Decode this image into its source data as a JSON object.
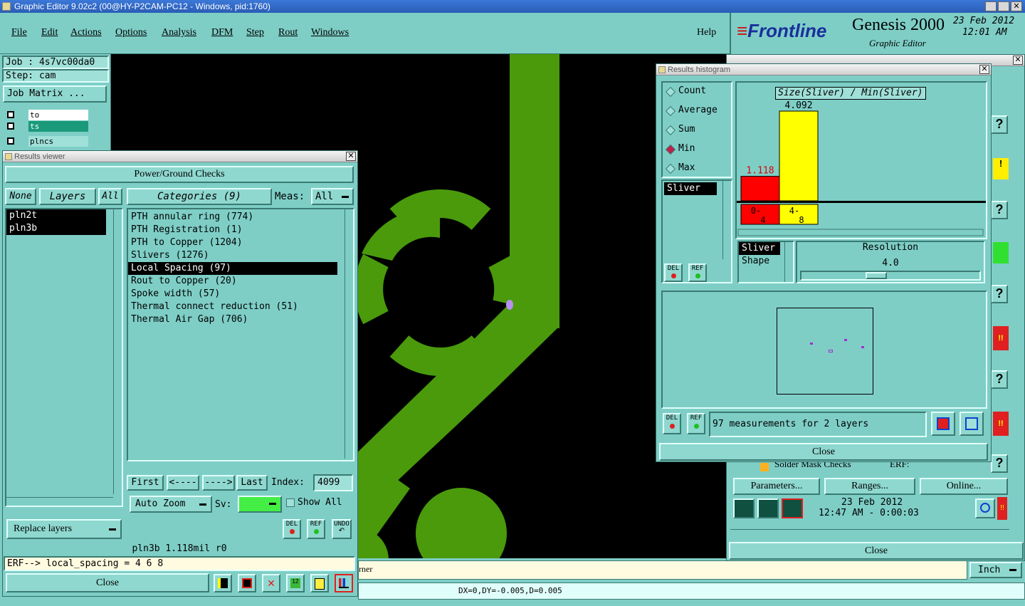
{
  "os_titlebar": {
    "title": "Graphic Editor 9.02c2 (00@HY-P2CAM-PC12 - Windows, pid:1760)"
  },
  "menu": {
    "items": [
      "File",
      "Edit",
      "Actions",
      "Options",
      "Analysis",
      "DFM",
      "Step",
      "Rout",
      "Windows"
    ],
    "help": "Help"
  },
  "brand": {
    "logo": "Frontline",
    "product": "Genesis 2000",
    "subtitle": "Graphic Editor",
    "date": "23 Feb 2012",
    "time": "12:01 AM"
  },
  "job_panel": {
    "job": "Job : 4s7vc00da0",
    "step": "Step: cam",
    "job_matrix": "Job Matrix ...",
    "layers": [
      {
        "name": "to"
      },
      {
        "name": "ts"
      },
      {
        "name": "plncs"
      }
    ]
  },
  "results_viewer": {
    "title": "Results viewer",
    "group": "Power/Ground Checks",
    "none_btn": "None",
    "layers_btn": "Layers",
    "all_btn": "All",
    "categories_btn": "Categories (9)",
    "meas_label": "Meas:",
    "meas_value": "All",
    "layer_list": [
      "pln2t",
      "pln3b"
    ],
    "categories": [
      "PTH annular ring (774)",
      "PTH Registration (1)",
      "PTH to Copper (1204)",
      "Slivers (1276)",
      "Local Spacing (97)",
      "Rout to Copper (20)",
      "Spoke width (57)",
      "Thermal connect reduction (51)",
      "Thermal Air Gap (706)"
    ],
    "selected_category": 4,
    "first": "First",
    "prev": "<----",
    "next": "---->",
    "last": "Last",
    "index_label": "Index:",
    "index_value": "4099",
    "auto_zoom": "Auto Zoom",
    "sv_label": "Sv:",
    "show_all": "Show All",
    "replace_layers": "Replace layers",
    "status_line": "pln3b 1.118mil  r0",
    "erf_line": "ERF--> local_spacing = 4 6 8",
    "close": "Close",
    "del": "DEL",
    "ref": "REF",
    "undo": "UNDO"
  },
  "results_histogram": {
    "title": "Results histogram",
    "modes": [
      "Count",
      "Average",
      "Sum",
      "Min",
      "Max"
    ],
    "selected_mode": "Min",
    "chart_title": "Size(Sliver) / Min(Sliver)",
    "list_item": "Sliver",
    "shape_items": [
      "Sliver",
      "Shape"
    ],
    "resolution_label": "Resolution",
    "resolution_value": "4.0",
    "summary": "97 measurements for 2 layers",
    "close": "Close",
    "del": "DEL",
    "ref": "REF",
    "chart_data": {
      "type": "bar",
      "categories": [
        "0-4",
        "4-8"
      ],
      "values": [
        1.118,
        4.092
      ],
      "colors": [
        "#ff0000",
        "#ffff00"
      ],
      "value_label_colors": [
        "#e00000",
        "#000000"
      ],
      "title": "Size(Sliver) / Min(Sliver)"
    }
  },
  "checklist": {
    "solder_mask": "Solder Mask Checks",
    "erf": "ERF:",
    "parameters": "Parameters...",
    "ranges": "Ranges...",
    "online": "Online...",
    "date": "23 Feb 2012",
    "time": "12:47 AM - 0:00:03",
    "close": "Close"
  },
  "bottom": {
    "message": "rner",
    "units": "Inch",
    "coords": "DX=0,DY=-0.005,D=0.005"
  },
  "colors": {
    "panel": "#7ecec6",
    "canvas": "#000000",
    "copper": "#4a9a0c",
    "highlight": "#b890f0"
  }
}
